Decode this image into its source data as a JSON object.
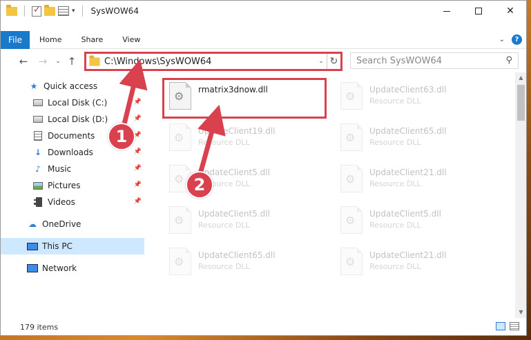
{
  "window": {
    "title": "SysWOW64",
    "controls": {
      "minimize": "",
      "maximize": "",
      "close": "✕"
    }
  },
  "ribbon": {
    "tabs": [
      "File",
      "Home",
      "Share",
      "View"
    ],
    "help": "?"
  },
  "address": {
    "path": "C:\\Windows\\SysWOW64",
    "search_placeholder": "Search SysWOW64"
  },
  "sidebar": {
    "items": [
      {
        "label": "Quick access",
        "icon": "star-icon",
        "pinned": false
      },
      {
        "label": "Local Disk (C:)",
        "icon": "disk-icon",
        "pinned": true
      },
      {
        "label": "Local Disk (D:)",
        "icon": "disk-icon",
        "pinned": true
      },
      {
        "label": "Documents",
        "icon": "documents-icon",
        "pinned": true
      },
      {
        "label": "Downloads",
        "icon": "downloads-icon",
        "pinned": true
      },
      {
        "label": "Music",
        "icon": "music-icon",
        "pinned": true
      },
      {
        "label": "Pictures",
        "icon": "pictures-icon",
        "pinned": true
      },
      {
        "label": "Videos",
        "icon": "videos-icon",
        "pinned": true
      },
      {
        "label": "OneDrive",
        "icon": "onedrive-icon",
        "pinned": false
      },
      {
        "label": "This PC",
        "icon": "this-pc-icon",
        "pinned": false,
        "selected": true
      },
      {
        "label": "Network",
        "icon": "network-icon",
        "pinned": false
      }
    ]
  },
  "files": [
    {
      "name": "rmatrix3dnow.dll",
      "type": "",
      "highlighted": true
    },
    {
      "name": "UpdateClient63.dll",
      "type": "Resource DLL"
    },
    {
      "name": "UpdateClient19.dll",
      "type": "Resource DLL"
    },
    {
      "name": "UpdateClient65.dll",
      "type": "Resource DLL"
    },
    {
      "name": "UpdateClient5.dll",
      "type": "Resource DLL"
    },
    {
      "name": "UpdateClient21.dll",
      "type": "Resource DLL"
    },
    {
      "name": "UpdateClient5.dll",
      "type": "Resource DLL"
    },
    {
      "name": "UpdateClient5.dll",
      "type": "Resource DLL"
    },
    {
      "name": "UpdateClient65.dll",
      "type": "Resource DLL"
    },
    {
      "name": "UpdateClient21.dll",
      "type": "Resource DLL"
    }
  ],
  "status": {
    "item_count": "179 items"
  },
  "annotations": {
    "step1": "1",
    "step2": "2",
    "color": "#d9414f"
  }
}
